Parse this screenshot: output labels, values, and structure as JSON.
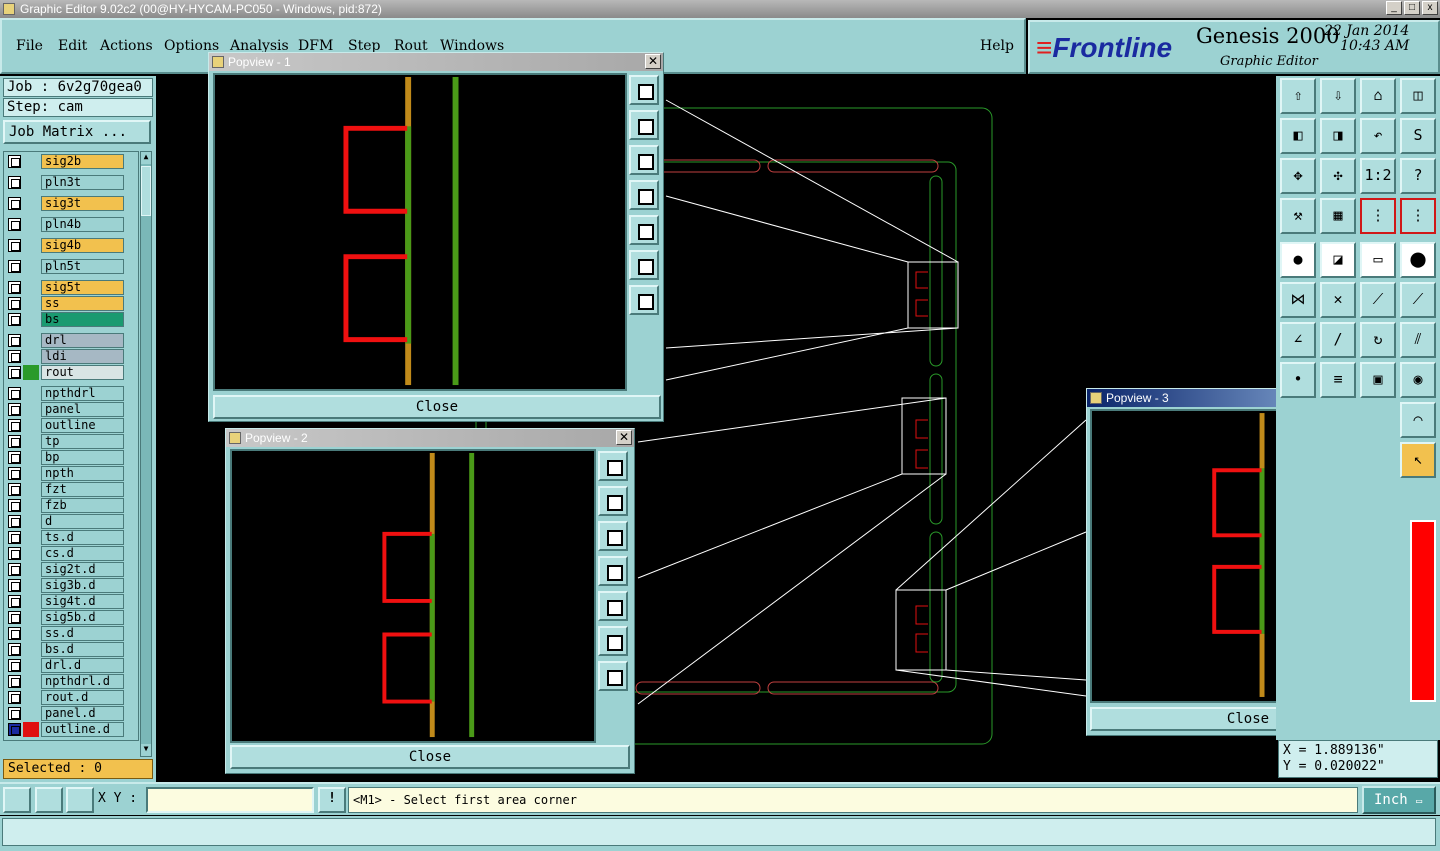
{
  "window": {
    "title": "Graphic Editor 9.02c2 (00@HY-HYCAM-PC050 - Windows, pid:872)"
  },
  "menu": {
    "file": "File",
    "edit": "Edit",
    "actions": "Actions",
    "options": "Options",
    "analysis": "Analysis",
    "dfm": "DFM",
    "step": "Step",
    "rout": "Rout",
    "windows": "Windows",
    "help": "Help"
  },
  "brand": {
    "logo": "Frontline",
    "product": "Genesis 2000",
    "subtitle": "Graphic Editor",
    "date": "22 Jan 2014",
    "time": "10:43 AM"
  },
  "job": {
    "job_label": "Job : 6v2g70gea0",
    "step_label": "Step: cam",
    "matrix_button": "Job Matrix ..."
  },
  "layers": [
    {
      "name": "sig2b",
      "color": "#f2c14e",
      "group": 1
    },
    {
      "name": "pln3t",
      "color": "#9cd2d2",
      "group": 1
    },
    {
      "name": "sig3t",
      "color": "#f2c14e",
      "group": 1
    },
    {
      "name": "pln4b",
      "color": "#9cd2d2",
      "group": 1
    },
    {
      "name": "sig4b",
      "color": "#f2c14e",
      "group": 1
    },
    {
      "name": "pln5t",
      "color": "#9cd2d2",
      "group": 1
    },
    {
      "name": "sig5t",
      "color": "#f2c14e",
      "group": 1
    },
    {
      "name": "ss",
      "color": "#f2c14e",
      "group": 1
    },
    {
      "name": "bs",
      "color": "#1a9a70",
      "group": 1
    },
    {
      "name": "drl",
      "color": "#a6b8c4",
      "group": 2
    },
    {
      "name": "ldi",
      "color": "#a6b8c4",
      "group": 2
    },
    {
      "name": "rout",
      "color": "#d8e4e4",
      "group": 2,
      "swatch": "#2a9a2a"
    },
    {
      "name": "npthdrl",
      "color": "#9cd2d2",
      "group": 3
    },
    {
      "name": "panel",
      "color": "#9cd2d2",
      "group": 3
    },
    {
      "name": "outline",
      "color": "#9cd2d2",
      "group": 3
    },
    {
      "name": "tp",
      "color": "#9cd2d2",
      "group": 3
    },
    {
      "name": "bp",
      "color": "#9cd2d2",
      "group": 3
    },
    {
      "name": "npth",
      "color": "#9cd2d2",
      "group": 3
    },
    {
      "name": "fzt",
      "color": "#9cd2d2",
      "group": 3
    },
    {
      "name": "fzb",
      "color": "#9cd2d2",
      "group": 3
    },
    {
      "name": "d",
      "color": "#9cd2d2",
      "group": 3
    },
    {
      "name": "ts.d",
      "color": "#9cd2d2",
      "group": 3
    },
    {
      "name": "cs.d",
      "color": "#9cd2d2",
      "group": 3
    },
    {
      "name": "sig2t.d",
      "color": "#9cd2d2",
      "group": 3
    },
    {
      "name": "sig3b.d",
      "color": "#9cd2d2",
      "group": 3
    },
    {
      "name": "sig4t.d",
      "color": "#9cd2d2",
      "group": 3
    },
    {
      "name": "sig5b.d",
      "color": "#9cd2d2",
      "group": 3
    },
    {
      "name": "ss.d",
      "color": "#9cd2d2",
      "group": 3
    },
    {
      "name": "bs.d",
      "color": "#9cd2d2",
      "group": 3
    },
    {
      "name": "drl.d",
      "color": "#9cd2d2",
      "group": 3
    },
    {
      "name": "npthdrl.d",
      "color": "#9cd2d2",
      "group": 3
    },
    {
      "name": "rout.d",
      "color": "#9cd2d2",
      "group": 3
    },
    {
      "name": "panel.d",
      "color": "#9cd2d2",
      "group": 3
    },
    {
      "name": "outline.d",
      "color": "#9cd2d2",
      "group": 3,
      "swatch": "#e01010",
      "active": true
    }
  ],
  "selected": "Selected : 0",
  "popviews": [
    {
      "title": "Popview - 1",
      "close": "Close"
    },
    {
      "title": "Popview - 2",
      "close": "Close"
    },
    {
      "title": "Popview - 3",
      "close": "Close"
    }
  ],
  "bottom": {
    "xy_label": "X Y :",
    "xy_value": "",
    "alert": "!",
    "prompt": "<M1> - Select first area corner",
    "unit": "Inch"
  },
  "coords": {
    "x": "X = 1.889136\"",
    "y": "Y = 0.020022\""
  },
  "tools": {
    "one_to_one": "1:2",
    "help": "?"
  }
}
